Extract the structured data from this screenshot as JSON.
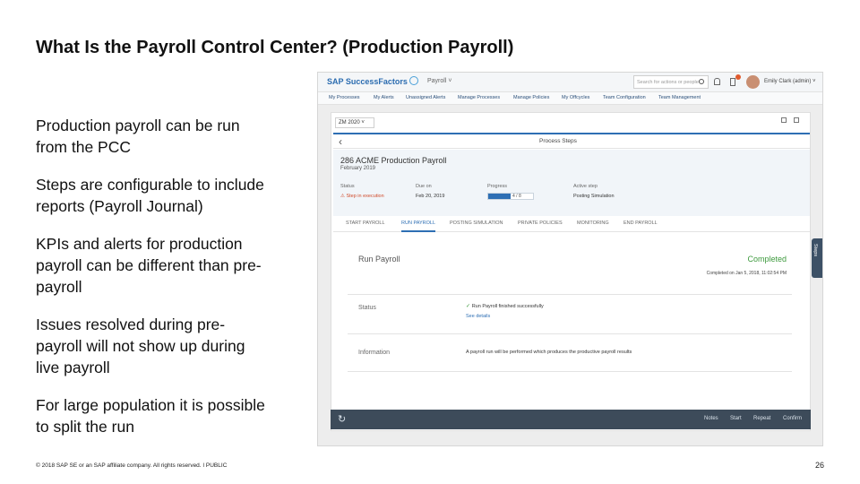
{
  "slide": {
    "title": "What Is the Payroll Control Center? (Production Payroll)",
    "bullets": [
      "Production payroll can be run\nfrom the PCC",
      "Steps are configurable to include\nreports (Payroll Journal)",
      "KPIs and alerts for production\npayroll can be different than pre-\npayroll",
      "Issues resolved during pre-\npayroll will not show up during\nlive payroll",
      "For large population it is possible\nto split the run"
    ],
    "footer": "© 2018 SAP SE or an SAP affiliate company. All rights reserved.  ǀ  PUBLIC",
    "page_number": "26"
  },
  "screenshot": {
    "header": {
      "logo": "SAP SuccessFactors",
      "module": "Payroll ˅",
      "search_placeholder": "Search for actions or people",
      "user": "Emily Clark (admin) ˅"
    },
    "nav": [
      "My Processes",
      "My Alerts",
      "Unassigned Alerts",
      "Manage Processes",
      "Manage Policies",
      "My Offcycles",
      "Team Configuration",
      "Team Management"
    ],
    "period": "ZM 2020 ˅",
    "process_steps_title": "Process Steps",
    "process": {
      "title": "286 ACME Production Payroll",
      "date": "February 2019",
      "status_label": "Status",
      "status_value": "⚠ Step in execution",
      "due_label": "Due on",
      "due_value": "Feb 20, 2019",
      "progress_label": "Progress",
      "progress_value": 0.5,
      "progress_text": "4 / 8",
      "active_label": "Active step",
      "active_value": "Posting Simulation"
    },
    "tabs": [
      "START PAYROLL",
      "RUN PAYROLL",
      "POSTING SIMULATION",
      "PRIVATE POLICIES",
      "MONITORING",
      "END PAYROLL"
    ],
    "active_tab": 1,
    "panel": {
      "title": "Run Payroll",
      "state": "Completed",
      "completed_on": "Completed on Jan 5, 2018, 11:02:54 PM",
      "status_label": "Status",
      "status_text": "Run Payroll finished successfully",
      "see_details": "See details",
      "info_label": "Information",
      "info_text": "A payroll run will be performed which produces the productive payroll results"
    },
    "side_tab": "Steps",
    "bottom_bar": [
      "Notes",
      "Start",
      "Repeat",
      "Confirm"
    ],
    "colors": {
      "accent": "#2e6fb4",
      "success": "#3e9a3e",
      "warning": "#d04a2a",
      "bar": "#3d4b5a"
    }
  }
}
